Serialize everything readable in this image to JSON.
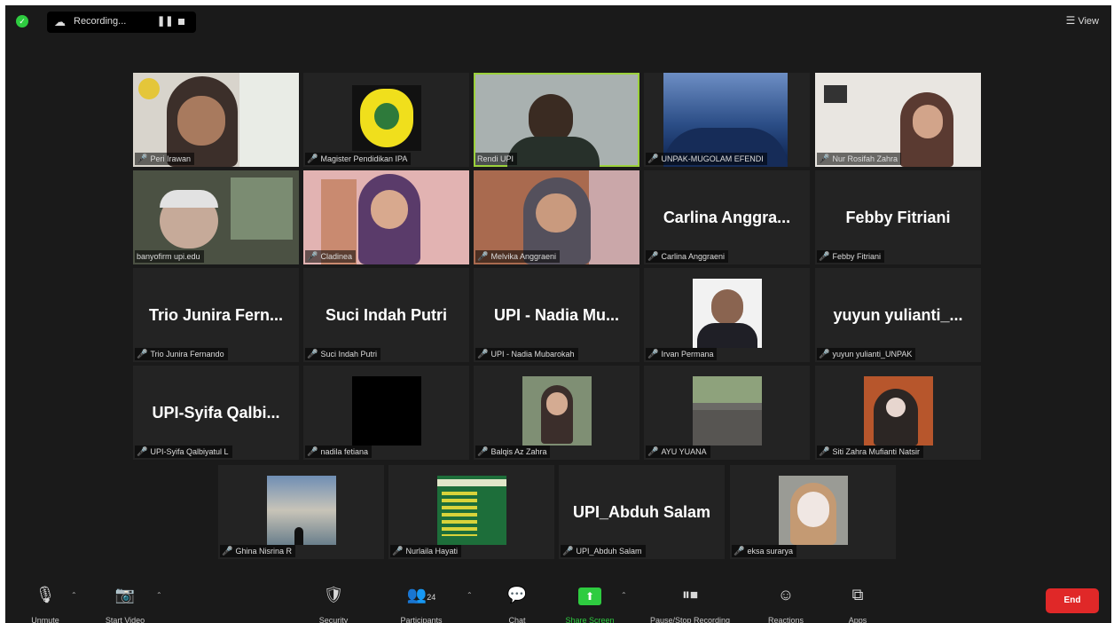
{
  "topbar": {
    "recording_label": "Recording...",
    "pause_glyph": "❚❚",
    "view_label": "View"
  },
  "participants": [
    {
      "name": "Peri Irawan",
      "big": "",
      "active": false
    },
    {
      "name": "Magister Pendidikan IPA",
      "big": "",
      "active": false
    },
    {
      "name": "Rendi UPI",
      "big": "",
      "active": true
    },
    {
      "name": "UNPAK-MUGOLAM EFENDI",
      "big": "",
      "active": false
    },
    {
      "name": "Nur Rosifah Zahra",
      "big": "",
      "active": false
    },
    {
      "name": "banyofirm upi.edu",
      "big": "",
      "active": false
    },
    {
      "name": "Cladinea",
      "big": "",
      "active": false
    },
    {
      "name": "Melvika Anggraeni",
      "big": "",
      "active": false
    },
    {
      "name": "Carlina Anggraeni",
      "big": "Carlina Anggra...",
      "active": false
    },
    {
      "name": "Febby Fitriani",
      "big": "Febby Fitriani",
      "active": false
    },
    {
      "name": "Trio Junira Fernando",
      "big": "Trio Junira Fern...",
      "active": false
    },
    {
      "name": "Suci Indah Putri",
      "big": "Suci Indah Putri",
      "active": false
    },
    {
      "name": "UPI - Nadia Mubarokah",
      "big": "UPI - Nadia Mu...",
      "active": false
    },
    {
      "name": "Irvan Permana",
      "big": "",
      "active": false
    },
    {
      "name": "yuyun yulianti_UNPAK",
      "big": "yuyun yulianti_...",
      "active": false
    },
    {
      "name": "UPI-Syifa Qalbiyatul L",
      "big": "UPI-Syifa Qalbi...",
      "active": false
    },
    {
      "name": "nadila fetiana",
      "big": "",
      "active": false
    },
    {
      "name": "Balqis Az Zahra",
      "big": "",
      "active": false
    },
    {
      "name": "AYU YUANA",
      "big": "",
      "active": false
    },
    {
      "name": "Siti Zahra Mufianti Natsir",
      "big": "",
      "active": false
    },
    {
      "name": "Ghina Nisrina R",
      "big": "",
      "active": false
    },
    {
      "name": "Nurlaila Hayati",
      "big": "",
      "active": false
    },
    {
      "name": "UPI_Abduh Salam",
      "big": "UPI_Abduh Salam",
      "active": false
    },
    {
      "name": "eksa surarya",
      "big": "",
      "active": false
    }
  ],
  "toolbar": {
    "unmute": "Unmute",
    "start_video": "Start Video",
    "security": "Security",
    "participants": "Participants",
    "participant_count": "24",
    "chat": "Chat",
    "share_screen": "Share Screen",
    "pause_stop_recording": "Pause/Stop Recording",
    "reactions": "Reactions",
    "apps": "Apps",
    "end": "End"
  },
  "colors": {
    "accent_green": "#2ecc40",
    "active_speaker": "#9bd13b",
    "end_red": "#e02828",
    "muted_red": "#e03535",
    "background": "#1a1a1a",
    "tile": "#232323"
  }
}
